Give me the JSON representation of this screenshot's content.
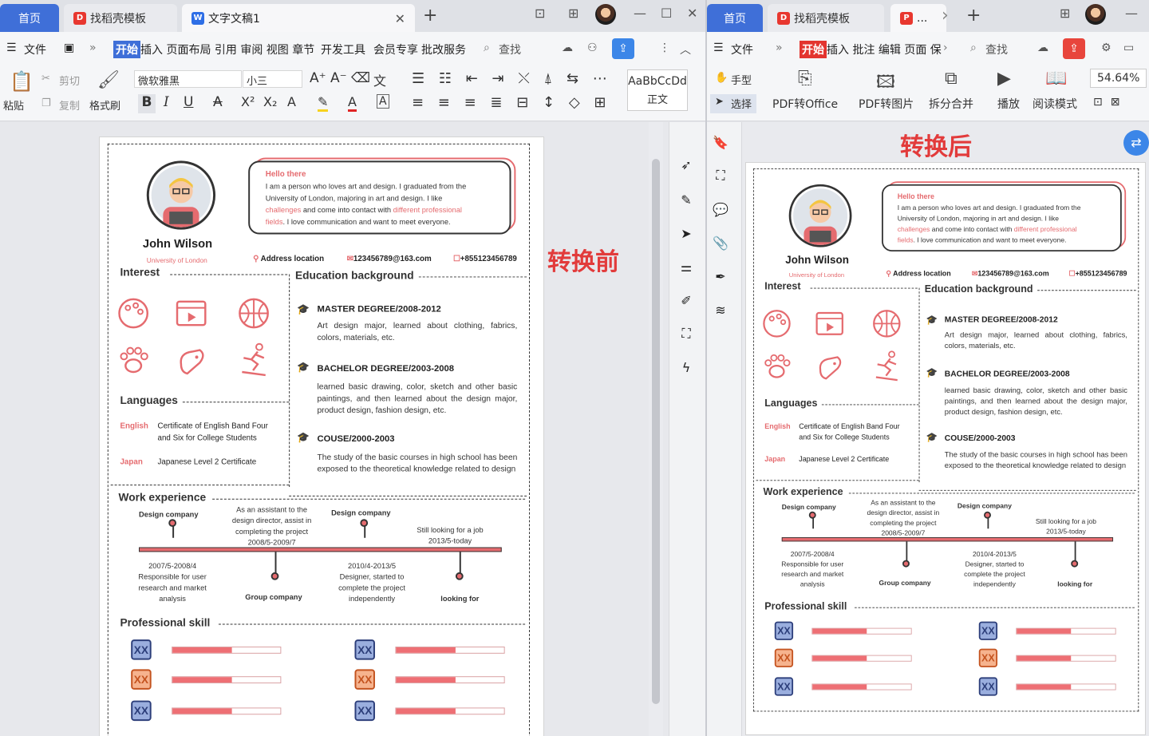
{
  "left": {
    "tabs": {
      "home": "首页",
      "template": "找稻壳模板",
      "doc": "文字文稿1"
    },
    "menu": {
      "file": "文件",
      "start": "开始",
      "items": "插入 页面布局 引用 审阅 视图 章节",
      "dev": "开发工具",
      "member": "会员专享",
      "batch": "批改服务",
      "search": "查找"
    },
    "toolbar": {
      "paste": "粘贴",
      "cut": "剪切",
      "copy": "复制",
      "format_painter": "格式刷",
      "font_name": "微软雅黑",
      "font_size": "小三",
      "style_sample": "AaBbCcDd",
      "style_name": "正文"
    },
    "overlay_label": "转换前"
  },
  "right": {
    "tabs": {
      "home": "首页",
      "template": "找稻壳模板",
      "doc": "..."
    },
    "menu": {
      "file": "文件",
      "start": "开始",
      "items": "插入 批注 编辑 页面 保",
      "search": "查找"
    },
    "toolbar": {
      "hand": "手型",
      "select": "选择",
      "pdf_office": "PDF转Office",
      "pdf_image": "PDF转图片",
      "split_merge": "拆分合并",
      "play": "播放",
      "read_mode": "阅读模式",
      "zoom": "54.64%"
    },
    "overlay_label": "转换后"
  },
  "resume": {
    "hello": "Hello there",
    "intro_1": "I am a person who loves art and design. I graduated from the",
    "intro_2": "University of London, majoring in art and design. I like",
    "intro_3a": "challenges",
    "intro_3b": " and come into contact with ",
    "intro_3c": "different professional",
    "intro_4a": "fields",
    "intro_4b": ". I love communication and want to meet everyone.",
    "name": "John Wilson",
    "school": "University of London",
    "address": "Address location",
    "email": "123456789@163.com",
    "phone": "+855123456789",
    "interest": "Interest",
    "education": "Education background",
    "edu": [
      {
        "title": "MASTER DEGREE/2008-2012",
        "desc": "Art design major, learned about clothing, fabrics, colors, materials, etc."
      },
      {
        "title": "BACHELOR DEGREE/2003-2008",
        "desc": "learned basic drawing, color, sketch and other basic paintings, and then learned about the design major, product design, fashion design, etc."
      },
      {
        "title": "COUSE/2000-2003",
        "desc": "The study of the basic courses in high school has been exposed to the theoretical knowledge related to design"
      }
    ],
    "languages": "Languages",
    "lang1_label": "English",
    "lang1_text_1": "Certificate of English Band Four",
    "lang1_text_2": "and Six for College Students",
    "lang2_label": "Japan",
    "lang2_text": "Japanese Level 2 Certificate",
    "work": "Work experience",
    "work_items": {
      "c1": "Design company",
      "c1_note_1": "2007/5-2008/4",
      "c1_note_2": "Responsible for user",
      "c1_note_3": "research and market",
      "c1_note_4": "analysis",
      "c2_1": "As an assistant to the",
      "c2_2": "design director, assist in",
      "c2_3": "completing the project",
      "c2_4": "2008/5-2009/7",
      "c2_name": "Group company",
      "c3": "Design company",
      "c3_note_1": "2010/4-2013/5",
      "c3_note_2": "Designer, started to",
      "c3_note_3": "complete the project",
      "c3_note_4": "independently",
      "c4_1": "Still looking for a job",
      "c4_2": "2013/5-today",
      "c4_name": "looking for"
    },
    "skill": "Professional skill",
    "skill_badge": "XX",
    "skills": [
      0.55,
      0.55,
      0.55,
      0.55,
      0.55,
      0.55
    ]
  }
}
